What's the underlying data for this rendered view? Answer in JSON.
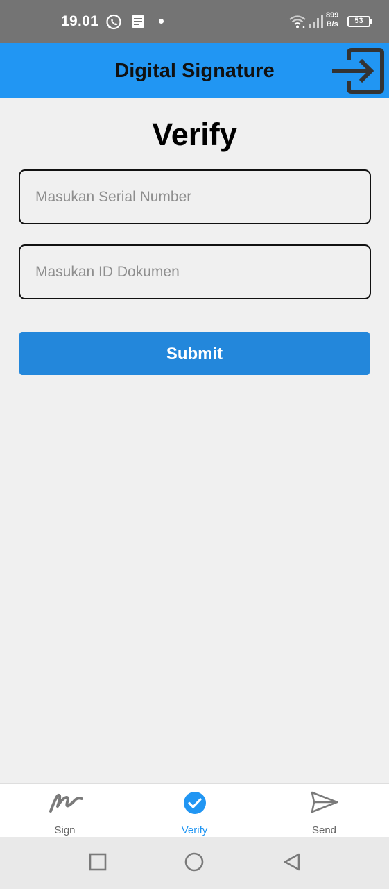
{
  "status_bar": {
    "time": "19.01",
    "net_speed_value": "899",
    "net_speed_unit": "B/s",
    "battery": "53",
    "icons": [
      "whatsapp-icon",
      "notes-icon",
      "dot-icon",
      "wifi-icon",
      "signal-icon",
      "battery-icon"
    ]
  },
  "app_bar": {
    "title": "Digital Signature",
    "action_icon": "login-icon"
  },
  "main": {
    "title": "Verify",
    "serial_field": {
      "value": "",
      "placeholder": "Masukan Serial Number"
    },
    "doc_field": {
      "value": "",
      "placeholder": "Masukan ID Dokumen"
    },
    "submit_label": "Submit"
  },
  "bottom_nav": {
    "selected": "Verify",
    "items": [
      {
        "label": "Sign",
        "icon": "signature-icon"
      },
      {
        "label": "Verify",
        "icon": "check-circle-icon"
      },
      {
        "label": "Send",
        "icon": "send-icon"
      }
    ]
  },
  "system_nav": {
    "icons": [
      "recent-apps-icon",
      "home-icon",
      "back-icon"
    ]
  },
  "colors": {
    "app_bar": "#2196f3",
    "button": "#2387db",
    "status_bar": "#747474",
    "background": "#f0f0f0"
  }
}
